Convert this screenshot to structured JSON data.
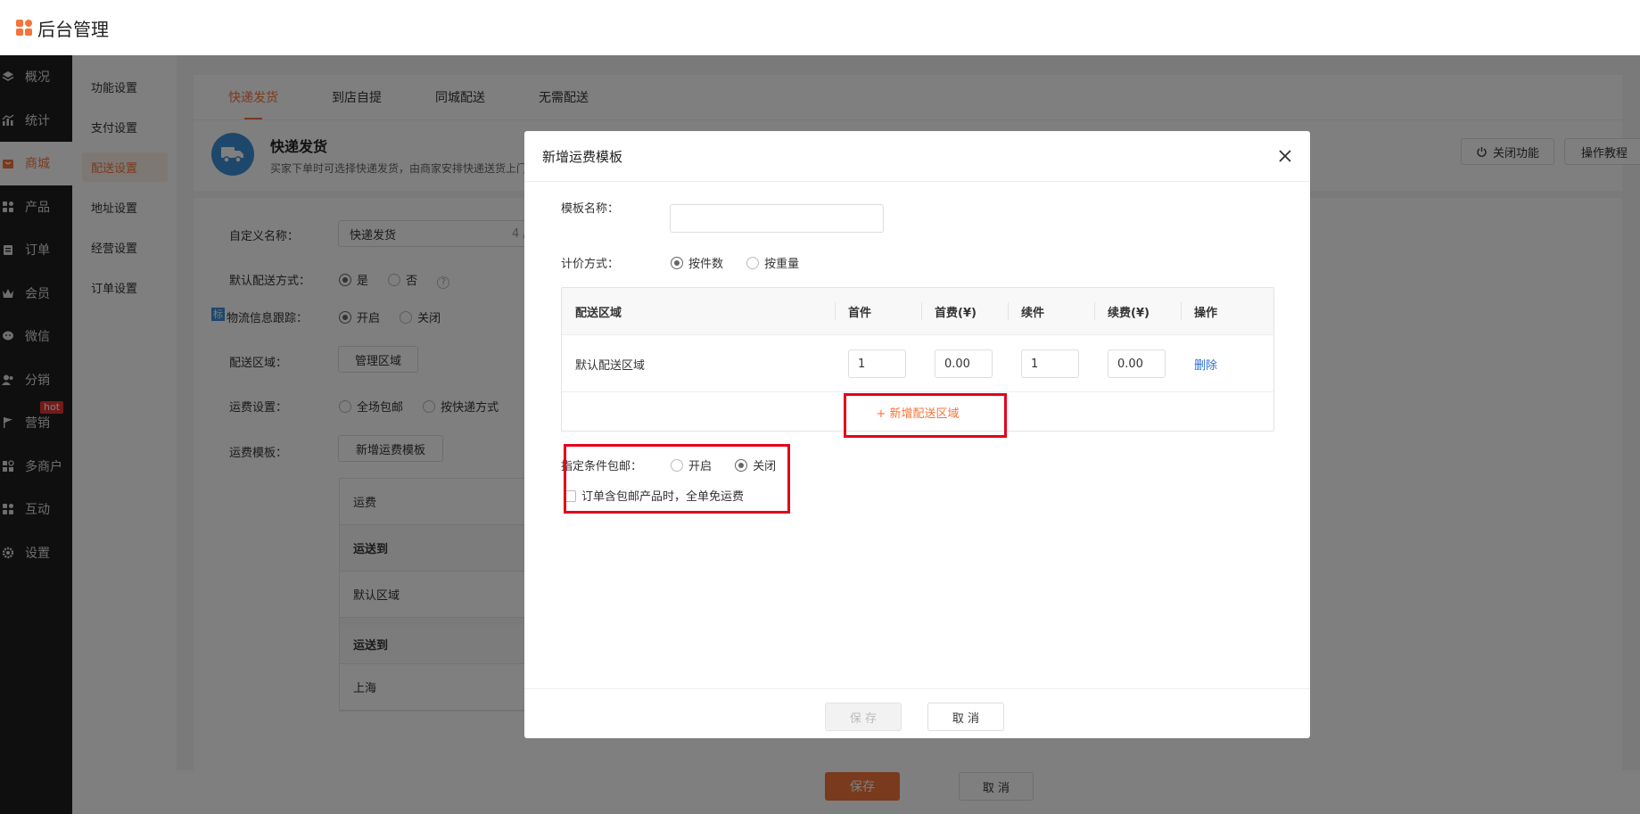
{
  "app": {
    "title": "后台管理"
  },
  "sidebar": {
    "items": [
      {
        "label": "概况",
        "icon": "layers-icon"
      },
      {
        "label": "统计",
        "icon": "chart-icon"
      },
      {
        "label": "商城",
        "icon": "shop-icon"
      },
      {
        "label": "产品",
        "icon": "grid-icon"
      },
      {
        "label": "订单",
        "icon": "order-icon"
      },
      {
        "label": "会员",
        "icon": "crown-icon"
      },
      {
        "label": "微信",
        "icon": "wechat-icon"
      },
      {
        "label": "分销",
        "icon": "users-icon"
      },
      {
        "label": "营销",
        "icon": "flag-icon",
        "badge": "hot"
      },
      {
        "label": "多商户",
        "icon": "store-icon"
      },
      {
        "label": "互动",
        "icon": "interact-icon"
      },
      {
        "label": "设置",
        "icon": "gear-icon"
      }
    ],
    "active_index": 2
  },
  "subnav": {
    "items": [
      "功能设置",
      "支付设置",
      "配送设置",
      "地址设置",
      "经营设置",
      "订单设置"
    ],
    "active_index": 2
  },
  "tabs": [
    "快递发货",
    "到店自提",
    "同城配送",
    "无需配送"
  ],
  "info": {
    "title": "快递发货",
    "desc": "买家下单时可选择快递发货，由商家安排快递送货上门",
    "close_btn": "关闭功能",
    "tutorial_btn": "操作教程"
  },
  "form": {
    "name_label": "自定义名称：",
    "name_value": "快递发货",
    "name_count": "4 /",
    "default_label": "默认配送方式：",
    "default_yes": "是",
    "default_no": "否",
    "track_tag": "标",
    "track_label": "物流信息跟踪：",
    "track_on": "开启",
    "track_off": "关闭",
    "area_label": "配送区域：",
    "area_btn": "管理区域",
    "fee_label": "运费设置：",
    "fee_opt1": "全场包邮",
    "fee_opt2": "按快递方式",
    "tpl_label": "运费模板：",
    "tpl_btn": "新增运费模板",
    "tpl_rows": [
      "运费",
      "运送到",
      "默认区域",
      "运送到",
      "上海"
    ]
  },
  "bottom": {
    "save": "保存",
    "cancel": "取 消"
  },
  "modal": {
    "title": "新增运费模板",
    "name_label": "模板名称：",
    "name_value": "",
    "pricing_label": "计价方式：",
    "pricing_opt1": "按件数",
    "pricing_opt2": "按重量",
    "table_headers": [
      "配送区域",
      "首件",
      "首费(¥)",
      "续件",
      "续费(¥)",
      "操作"
    ],
    "row": {
      "area": "默认配送区域",
      "first": "1",
      "first_fee": "0.00",
      "next": "1",
      "next_fee": "0.00",
      "action": "删除"
    },
    "add_area": "+ 新增配送区域",
    "free_label": "指定条件包邮：",
    "free_on": "开启",
    "free_off": "关闭",
    "free_check_label": "订单含包邮产品时，全单免运费",
    "save": "保 存",
    "cancel": "取 消"
  },
  "colors": {
    "accent": "#f5743b",
    "highlight_box": "#e3001b",
    "link": "#2d6fd1"
  }
}
